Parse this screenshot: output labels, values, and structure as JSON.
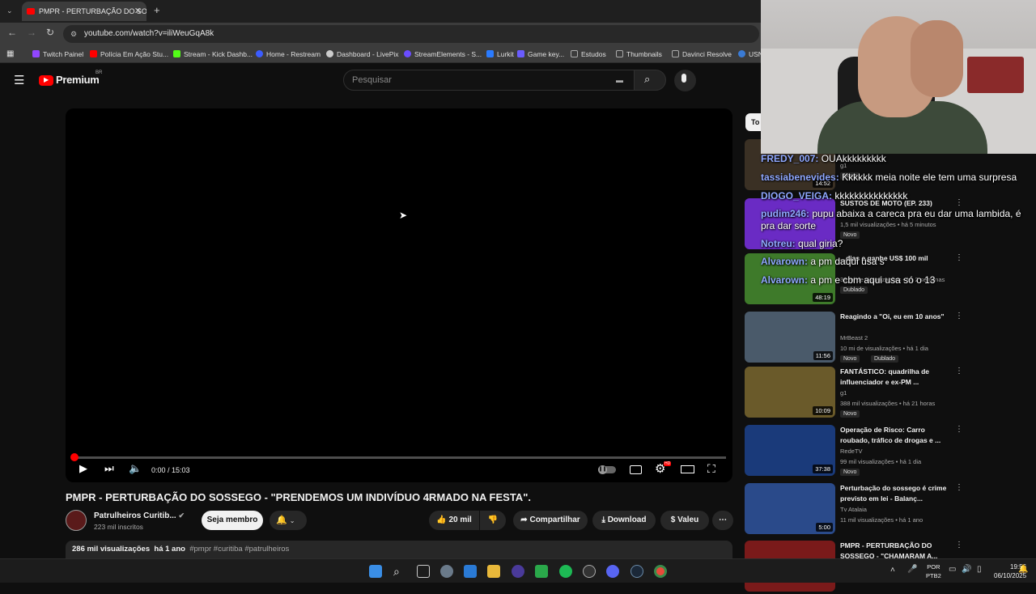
{
  "browser": {
    "tab_title": "PMPR - PERTURBAÇÃO DO SOSSEGO",
    "tab_close": "✕",
    "new_tab": "+",
    "url": "youtube.com/watch?v=iliWeuGqA8k",
    "bookmarks": [
      {
        "label": "Twitch Painel",
        "color": "#9146ff"
      },
      {
        "label": "Polícia Em Ação Stu...",
        "color": "#ff0000"
      },
      {
        "label": "Stream - Kick Dashb...",
        "color": "#53fc18"
      },
      {
        "label": "Home - Restream",
        "color": "#3b5cff"
      },
      {
        "label": "Dashboard - LivePix",
        "color": "#cccccc"
      },
      {
        "label": "StreamElements - S...",
        "color": "#6a4cff"
      },
      {
        "label": "Lurkit",
        "color": "#2a7bff"
      },
      {
        "label": "Game key...",
        "color": "#6a5cff"
      },
      {
        "label": "Estudos",
        "color": "#888888"
      },
      {
        "label": "Thumbnails",
        "color": "#888888"
      },
      {
        "label": "Davinci Resolve",
        "color": "#888888"
      },
      {
        "label": "USN",
        "color": "#3a7bd5"
      }
    ]
  },
  "youtube": {
    "logo_text": "Premium",
    "logo_region": "BR",
    "search_placeholder": "Pesquisar"
  },
  "player": {
    "time": "0:00 / 15:03",
    "progress": 0.0,
    "settings_badge": "HD"
  },
  "video": {
    "title": "PMPR - PERTURBAÇÃO DO SOSSEGO - \"PRENDEMOS UM INDIVÍDUO 4RMADO NA FESTA\".",
    "channel": "Patrulheiros Curitib...",
    "subscribers": "223 mil inscritos",
    "join_label": "Seja membro",
    "likes": "20 mil",
    "share_label": "Compartilhar",
    "download_label": "Download",
    "thanks_label": "Valeu",
    "views": "286 mil visualizações",
    "age": "há 1 ano",
    "tags": "#pmpr #curitiba #patrulheiros"
  },
  "sidebar": {
    "chip": "To",
    "recommendations": [
      {
        "title": "...suspeitos de...",
        "channel": "g1",
        "meta": "",
        "badges": [
          "Novo"
        ],
        "duration": "14:52",
        "thumb": "#3a3024"
      },
      {
        "title": "SUSTOS DE MOTO (EP. 233)",
        "channel": "",
        "meta": "1,5 mil visualizações • há 5 minutos",
        "badges": [
          "Novo"
        ],
        "duration": "",
        "thumb": "#6a2bc4"
      },
      {
        "title": "...dias e ganhe US$ 100 mil",
        "channel": "",
        "meta": "38 mi de visualizações • há 2 semanas",
        "badges": [
          "Dublado"
        ],
        "duration": "48:19",
        "thumb": "#3e7a2a"
      },
      {
        "title": "Reagindo a \"Oi, eu em 10 anos\"",
        "channel": "MrBeast 2",
        "meta": "10 mi de visualizações • há 1 dia",
        "badges": [
          "Novo",
          "Dublado"
        ],
        "duration": "11:56",
        "thumb": "#4a5a6a"
      },
      {
        "title": "FANTÁSTICO: quadrilha de influenciador e ex-PM ...",
        "channel": "g1",
        "meta": "388 mil visualizações • há 21 horas",
        "badges": [
          "Novo"
        ],
        "duration": "10:09",
        "thumb": "#6a5a2a"
      },
      {
        "title": "Operação de Risco: Carro roubado, tráfico de drogas e ...",
        "channel": "RedeTV",
        "meta": "99 mil visualizações • há 1 dia",
        "badges": [
          "Novo"
        ],
        "duration": "37:38",
        "thumb": "#1a3a7a"
      },
      {
        "title": "Perturbação do sossego é crime previsto em lei - Balanç...",
        "channel": "Tv Atalaia",
        "meta": "11 mil visualizações • há 1 ano",
        "badges": [],
        "duration": "5:00",
        "thumb": "#2a4a8a"
      },
      {
        "title": "PMPR - PERTURBAÇÃO DO SOSSEGO - \"CHAMARAM A...",
        "channel": "",
        "meta": "",
        "badges": [],
        "duration": "",
        "thumb": "#7a1a1a"
      }
    ]
  },
  "chat": [
    {
      "user": "FREDY_007:",
      "text": "OUAkkkkkkkkk"
    },
    {
      "user": "tassiabenevides:",
      "text": "Kkkkkk meia noite ele tem uma surpresa"
    },
    {
      "user": "DIOGO_VEIGA:",
      "text": "kkkkkkkkkkkkkkk"
    },
    {
      "user": "pudim246:",
      "text": "pupu abaixa a careca pra eu dar uma lambida, é"
    },
    {
      "user": "",
      "text": "pra dar sorte"
    },
    {
      "user": "Notreu:",
      "text": "qual giria?"
    },
    {
      "user": "Alvarown:",
      "text": "a pm daqui usa s"
    },
    {
      "user": "Alvarown:",
      "text": "a pm e cbm aqui usa só o 13"
    }
  ],
  "taskbar": {
    "lang": "POR",
    "layout": "PTB2",
    "time": "19:56",
    "date": "06/10/2025"
  }
}
